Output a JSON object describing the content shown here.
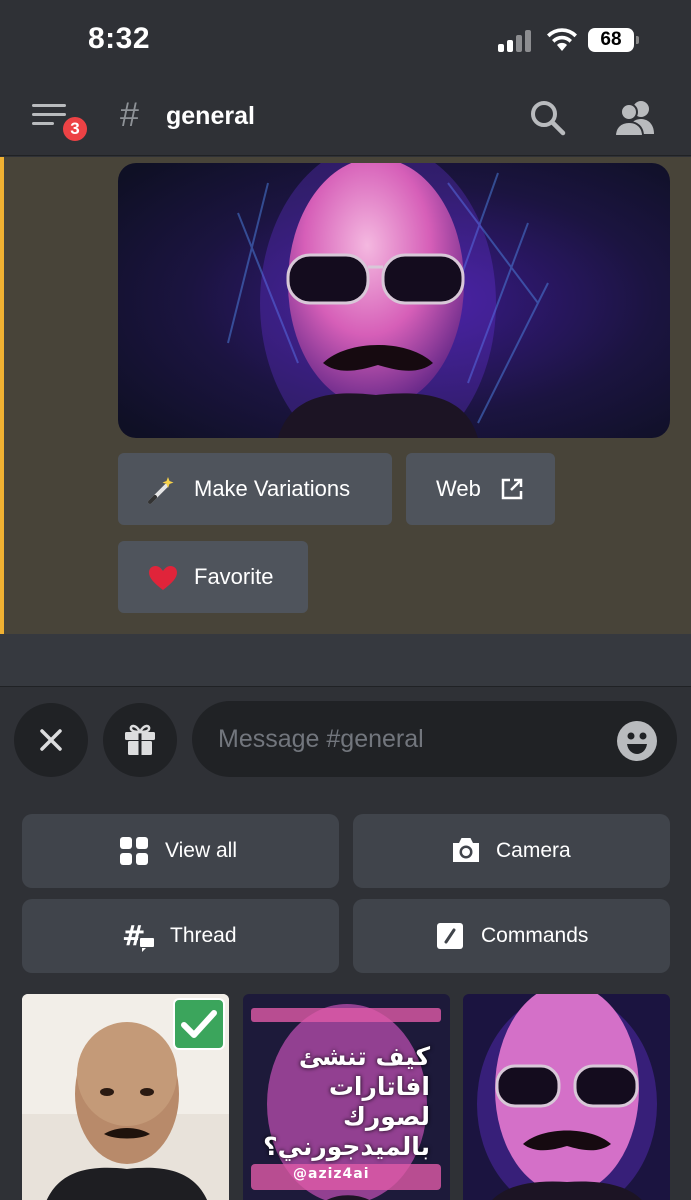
{
  "status_bar": {
    "time": "8:32",
    "battery": "68"
  },
  "header": {
    "hash_symbol": "#",
    "channel_name": "general",
    "notification_count": "3"
  },
  "message": {
    "image_alt": "AI avatar portrait",
    "buttons": [
      {
        "label": "Make Variations",
        "icon": "magic-wand-icon"
      },
      {
        "label": "Web",
        "icon": "external-link-icon"
      },
      {
        "label": "Favorite",
        "icon": "heart-icon"
      }
    ],
    "highlight_color": "#f0b132"
  },
  "composer": {
    "placeholder": "Message #general"
  },
  "panel": {
    "actions": [
      {
        "label": "View all",
        "icon": "grid-icon"
      },
      {
        "label": "Camera",
        "icon": "camera-icon"
      },
      {
        "label": "Thread",
        "icon": "thread-icon"
      },
      {
        "label": "Commands",
        "icon": "slash-command-icon"
      }
    ],
    "thumbnails": [
      {
        "selected": true
      },
      {
        "overlay_text": "كيف تنشئ افاتارات لصورك بالميدجورني؟",
        "handle": "@aziz4ai"
      },
      {
        "selected": false
      }
    ]
  },
  "colors": {
    "accent": "#f0b132",
    "badge": "#ed4245",
    "button": "#4f545c",
    "check": "#3ba55c"
  }
}
